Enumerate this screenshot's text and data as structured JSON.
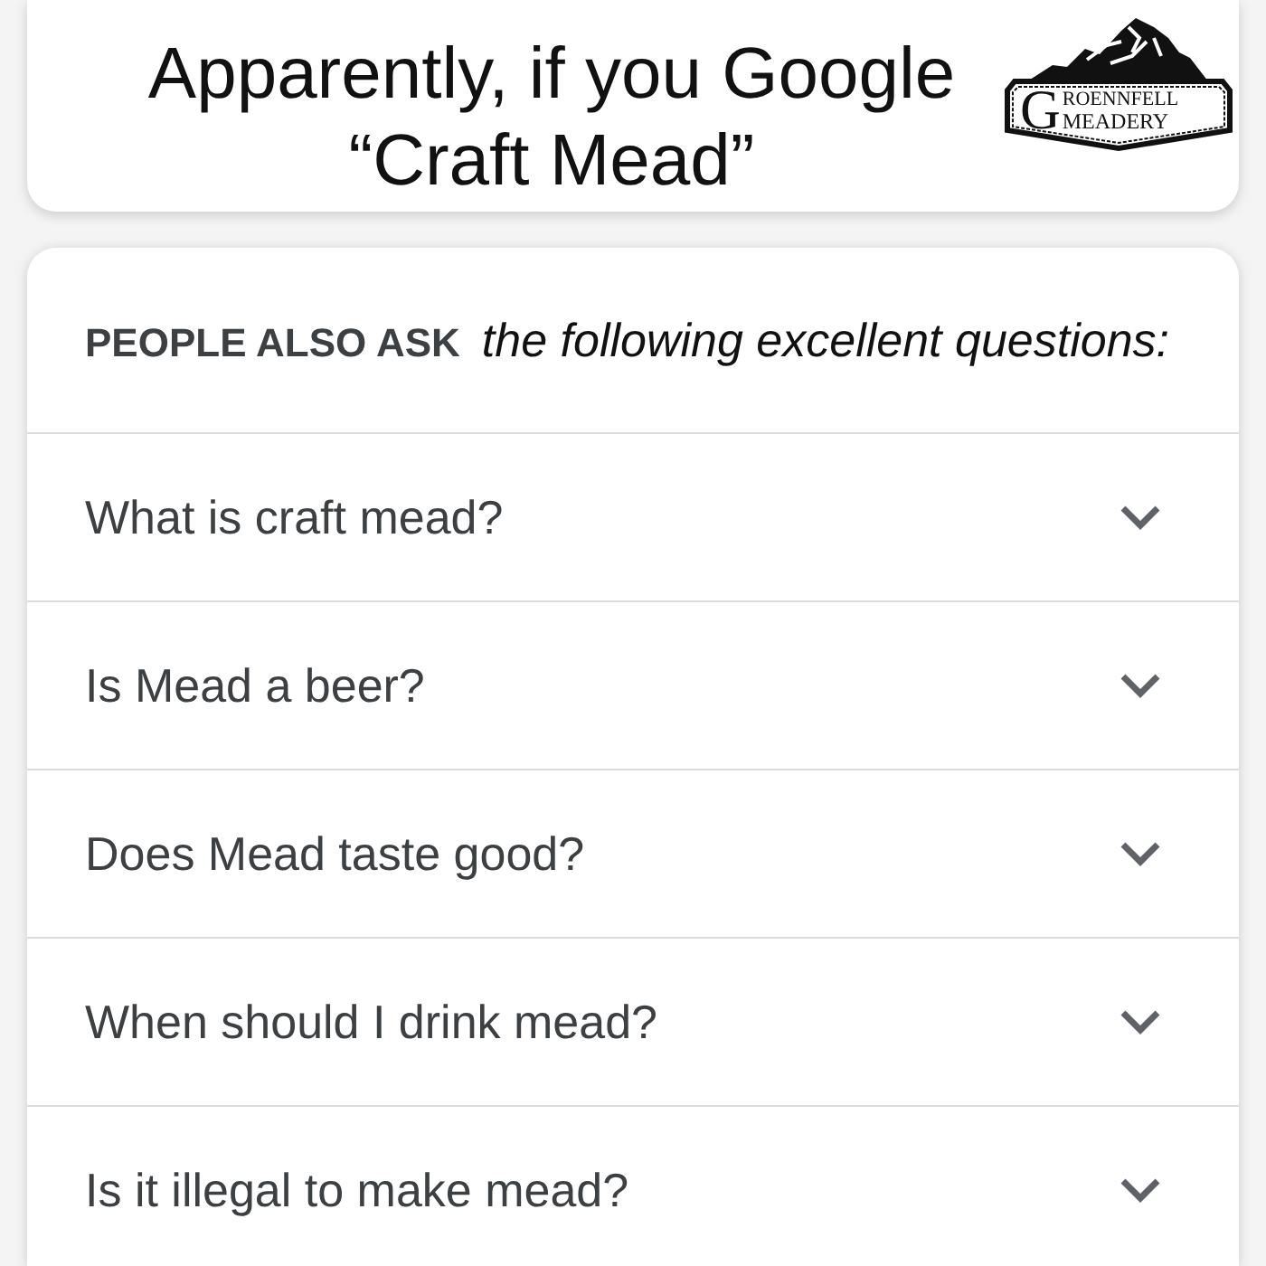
{
  "banner": {
    "title": "Apparently, if you Google “Craft Mead”",
    "logo": {
      "initial": "G",
      "line_1": "ROENNFELL",
      "line_2": "MEADERY"
    }
  },
  "panel": {
    "heading": "PEOPLE ALSO ASK",
    "subheading": "the following excellent questions:",
    "questions": [
      {
        "text": "What is craft mead?",
        "expanded": false
      },
      {
        "text": "Is Mead a beer?",
        "expanded": false
      },
      {
        "text": "Does Mead taste good?",
        "expanded": false
      },
      {
        "text": "When should I drink mead?",
        "expanded": false
      },
      {
        "text": "Is it illegal to make mead?",
        "expanded": false
      }
    ]
  }
}
